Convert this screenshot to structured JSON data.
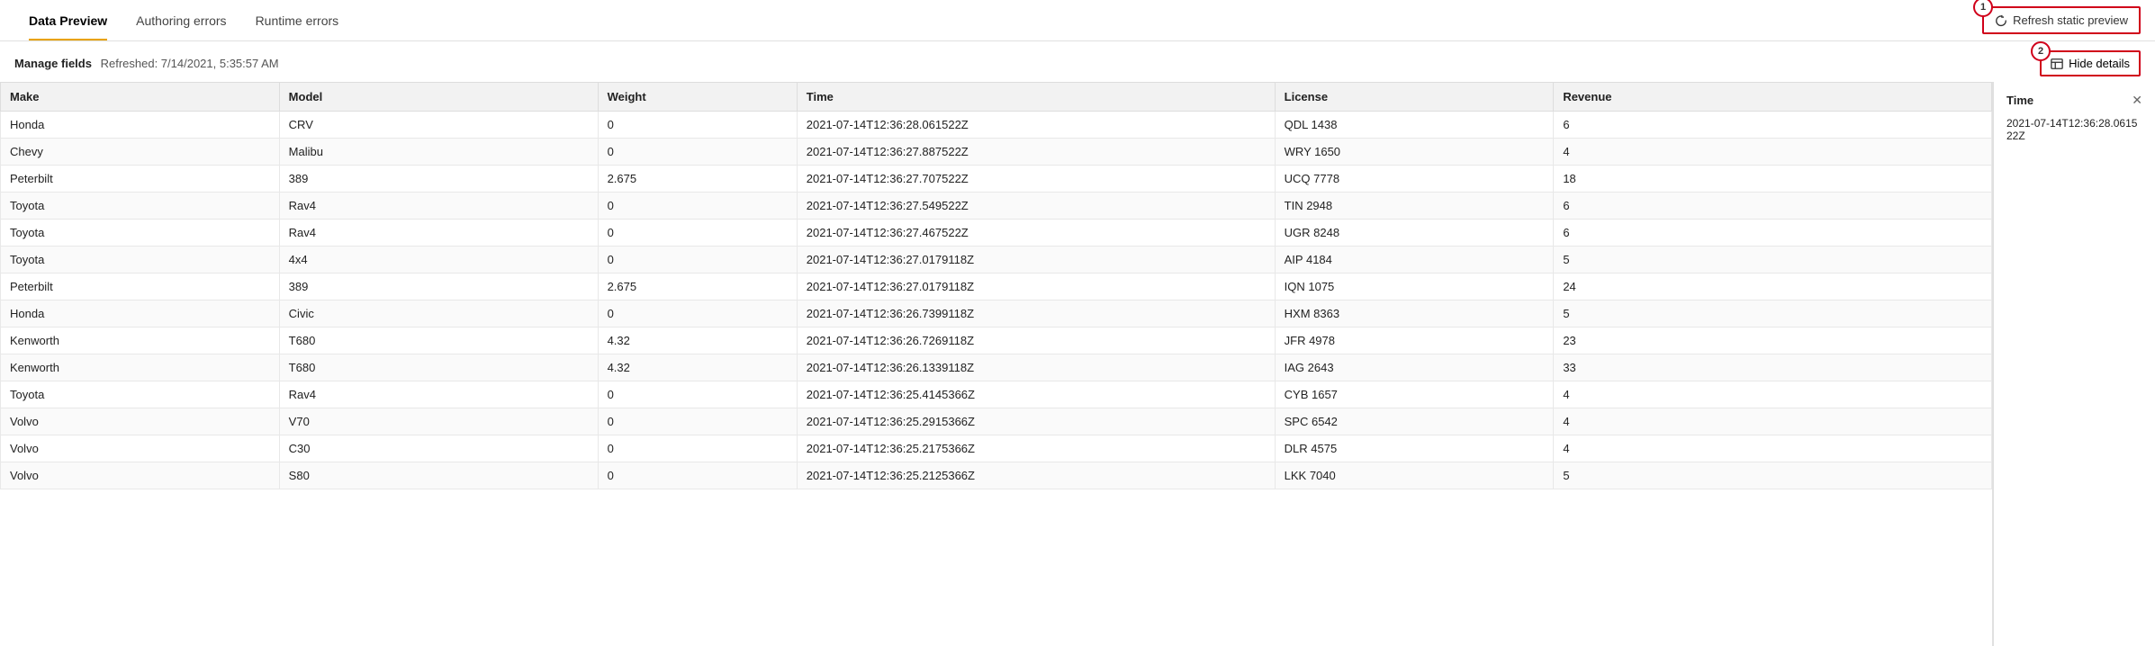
{
  "tabs": [
    {
      "id": "data-preview",
      "label": "Data Preview",
      "active": true
    },
    {
      "id": "authoring-errors",
      "label": "Authoring errors",
      "active": false
    },
    {
      "id": "runtime-errors",
      "label": "Runtime errors",
      "active": false
    }
  ],
  "toolbar": {
    "manage_label": "Manage fields",
    "refreshed_label": "Refreshed: 7/14/2021, 5:35:57 AM",
    "refresh_btn_label": "Refresh static preview",
    "hide_details_label": "Hide details",
    "badge1": "1",
    "badge2": "2"
  },
  "table": {
    "columns": [
      {
        "id": "make",
        "label": "Make"
      },
      {
        "id": "model",
        "label": "Model"
      },
      {
        "id": "weight",
        "label": "Weight"
      },
      {
        "id": "time",
        "label": "Time"
      },
      {
        "id": "license",
        "label": "License"
      },
      {
        "id": "revenue",
        "label": "Revenue"
      }
    ],
    "rows": [
      {
        "make": "Honda",
        "model": "CRV",
        "weight": "0",
        "time": "2021-07-14T12:36:28.061522Z",
        "license": "QDL 1438",
        "revenue": "6"
      },
      {
        "make": "Chevy",
        "model": "Malibu",
        "weight": "0",
        "time": "2021-07-14T12:36:27.887522Z",
        "license": "WRY 1650",
        "revenue": "4"
      },
      {
        "make": "Peterbilt",
        "model": "389",
        "weight": "2.675",
        "time": "2021-07-14T12:36:27.707522Z",
        "license": "UCQ 7778",
        "revenue": "18"
      },
      {
        "make": "Toyota",
        "model": "Rav4",
        "weight": "0",
        "time": "2021-07-14T12:36:27.549522Z",
        "license": "TIN 2948",
        "revenue": "6"
      },
      {
        "make": "Toyota",
        "model": "Rav4",
        "weight": "0",
        "time": "2021-07-14T12:36:27.467522Z",
        "license": "UGR 8248",
        "revenue": "6"
      },
      {
        "make": "Toyota",
        "model": "4x4",
        "weight": "0",
        "time": "2021-07-14T12:36:27.0179118Z",
        "license": "AIP 4184",
        "revenue": "5"
      },
      {
        "make": "Peterbilt",
        "model": "389",
        "weight": "2.675",
        "time": "2021-07-14T12:36:27.0179118Z",
        "license": "IQN 1075",
        "revenue": "24"
      },
      {
        "make": "Honda",
        "model": "Civic",
        "weight": "0",
        "time": "2021-07-14T12:36:26.7399118Z",
        "license": "HXM 8363",
        "revenue": "5"
      },
      {
        "make": "Kenworth",
        "model": "T680",
        "weight": "4.32",
        "time": "2021-07-14T12:36:26.7269118Z",
        "license": "JFR 4978",
        "revenue": "23"
      },
      {
        "make": "Kenworth",
        "model": "T680",
        "weight": "4.32",
        "time": "2021-07-14T12:36:26.1339118Z",
        "license": "IAG 2643",
        "revenue": "33"
      },
      {
        "make": "Toyota",
        "model": "Rav4",
        "weight": "0",
        "time": "2021-07-14T12:36:25.4145366Z",
        "license": "CYB 1657",
        "revenue": "4"
      },
      {
        "make": "Volvo",
        "model": "V70",
        "weight": "0",
        "time": "2021-07-14T12:36:25.2915366Z",
        "license": "SPC 6542",
        "revenue": "4"
      },
      {
        "make": "Volvo",
        "model": "C30",
        "weight": "0",
        "time": "2021-07-14T12:36:25.2175366Z",
        "license": "DLR 4575",
        "revenue": "4"
      },
      {
        "make": "Volvo",
        "model": "S80",
        "weight": "0",
        "time": "2021-07-14T12:36:25.2125366Z",
        "license": "LKK 7040",
        "revenue": "5"
      }
    ]
  },
  "side_panel": {
    "title": "Time",
    "value": "2021-07-14T12:36:28.061522Z"
  }
}
